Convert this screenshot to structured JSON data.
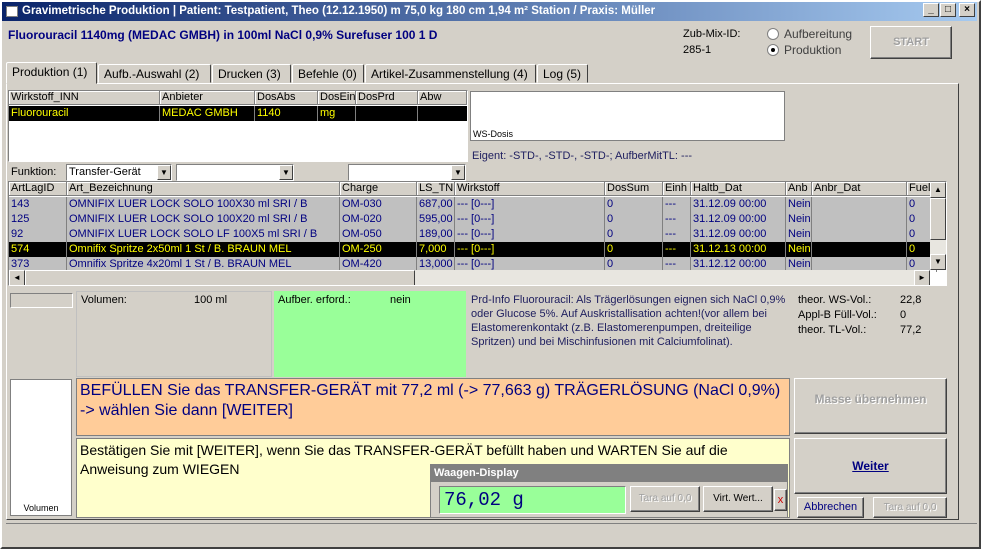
{
  "window": {
    "title": "Gravimetrische Produktion  |  Patient: Testpatient, Theo (12.12.1950) m 75,0 kg  180 cm  1,94 m² Station / Praxis: Müller",
    "minimize": "_",
    "maximize": "□",
    "close": "×"
  },
  "header": {
    "product": "Fluorouracil 1140mg (MEDAC GMBH) in 100ml NaCl 0,9% Surefuser 100 1 D",
    "zub_mix_label": "Zub-Mix-ID:",
    "zub_mix_value": "285-1",
    "radio_aufbereitung": "Aufbereitung",
    "radio_produktion": "Produktion",
    "start_button": "START"
  },
  "tabs": [
    "Produktion (1)",
    "Aufb.-Auswahl (2)",
    "Drucken (3)",
    "Befehle (0)",
    "Artikel-Zusammenstellung (4)",
    "Log (5)"
  ],
  "wirkstoff_table": {
    "headers": [
      "Wirkstoff_INN",
      "Anbieter",
      "DosAbs",
      "DosEin",
      "DosPrd",
      "Abw"
    ],
    "rows": [
      [
        "Fluorouracil",
        "MEDAC GMBH",
        "1140",
        "mg",
        "",
        ""
      ]
    ]
  },
  "ws_dosis_label": "WS-Dosis",
  "eigent": "Eigent: -STD-, -STD-, -STD-; AufberMitTL: ---",
  "funktion": {
    "label": "Funktion:",
    "value": "Transfer-Gerät",
    "combo2": "",
    "combo3": ""
  },
  "artikel_table": {
    "headers": [
      "ArtLagID",
      "Art_Bezeichnung",
      "Charge",
      "LS_TN",
      "Wirkstoff",
      "DosSum",
      "Einh",
      "Haltb_Dat",
      "Anb",
      "Anbr_Dat",
      "FuellV"
    ],
    "rows": [
      [
        "143",
        "OMNIFIX LUER LOCK SOLO    100X30 ml SRI   / B",
        "OM-030",
        "687,00",
        "--- [0---]",
        "0",
        "---",
        "31.12.09 00:00",
        "Nein",
        "",
        "0"
      ],
      [
        "125",
        "OMNIFIX LUER LOCK SOLO    100X20 ml SRI   / B",
        "OM-020",
        "595,00",
        "--- [0---]",
        "0",
        "---",
        "31.12.09 00:00",
        "Nein",
        "",
        "0"
      ],
      [
        "92",
        "OMNIFIX LUER LOCK SOLO LF    100X5 ml SRI   / B",
        "OM-050",
        "189,00",
        "--- [0---]",
        "0",
        "---",
        "31.12.09 00:00",
        "Nein",
        "",
        "0"
      ],
      [
        "574",
        "Omnifix Spritze 2x50ml    1 St   / B. BRAUN MEL",
        "OM-250",
        "7,000",
        "--- [0---]",
        "0",
        "---",
        "31.12.13 00:00",
        "Nein",
        "",
        "0"
      ],
      [
        "373",
        "Omnifix Spritze 4x20ml    1 St   / B. BRAUN MEL",
        "OM-420",
        "13,000",
        "--- [0---]",
        "0",
        "---",
        "31.12.12 00:00",
        "Nein",
        "",
        "0"
      ]
    ]
  },
  "info": {
    "volumen_label": "Volumen:",
    "volumen_value": "100 ml",
    "aufber_label": "Aufber. erford.:",
    "aufber_value": "nein",
    "prd_info": "Prd-Info Fluorouracil: Als Trägerlösungen eignen sich NaCl 0,9% oder Glucose 5%. Auf Auskristallisation achten!(vor allem bei Elastomerenkontakt (z.B. Elastomerenpumpen, dreiteilige Spritzen) und bei Mischinfusionen mit Calciumfolinat).",
    "theor_ws_label": "theor. WS-Vol.:",
    "theor_ws_value": "22,8",
    "applb_label": "Appl-B Füll-Vol.:",
    "applb_value": "0",
    "theor_tl_label": "theor. TL-Vol.:",
    "theor_tl_value": "77,2"
  },
  "instruction": {
    "main": "BEFÜLLEN Sie das TRANSFER-GERÄT mit  77,2 ml (-> 77,663 g) TRÄGERLÖSUNG (NaCl 0,9%) -> wählen Sie dann [WEITER]",
    "sub": "Bestätigen Sie mit [WEITER], wenn Sie das TRANSFER-GERÄT befüllt haben und WARTEN Sie auf die Anweisung zum WIEGEN"
  },
  "volumen_box_label": "Volumen",
  "waagen": {
    "title": "Waagen-Display",
    "value": "76,02  g",
    "tara": "Tara auf 0,0",
    "virt": "Virt. Wert...",
    "x": "x"
  },
  "buttons": {
    "masse": "Masse übernehmen",
    "weiter": "Weiter",
    "abbrechen": "Abbrechen",
    "tara2": "Tara auf 0,0"
  },
  "colors": {
    "title_start": "#0a246a",
    "title_end": "#a6caf0",
    "selected_row": "#000000",
    "selected_text": "#ffff00",
    "grid_gray": "#c0c0c0",
    "green": "#99ff99",
    "orange": "#ffcc99",
    "yellow": "#ffffcc",
    "header_blue": "#000080"
  }
}
